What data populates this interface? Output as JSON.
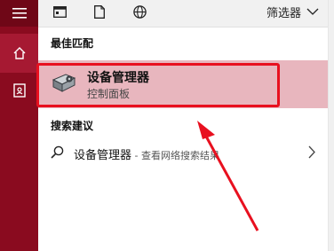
{
  "toolbar": {
    "filter_label": "筛选器"
  },
  "sections": {
    "best_match_title": "最佳匹配",
    "suggestions_title": "搜索建议"
  },
  "best_match": {
    "title": "设备管理器",
    "subtitle": "控制面板",
    "icon": "device-manager-icon"
  },
  "suggestion": {
    "query": "设备管理器",
    "suffix": " - 查看网络搜索结果",
    "icon": "search-icon"
  },
  "colors": {
    "rail": "#8a0b1f",
    "selected_bg": "#e8b6be",
    "highlight_border": "#e8101f"
  }
}
